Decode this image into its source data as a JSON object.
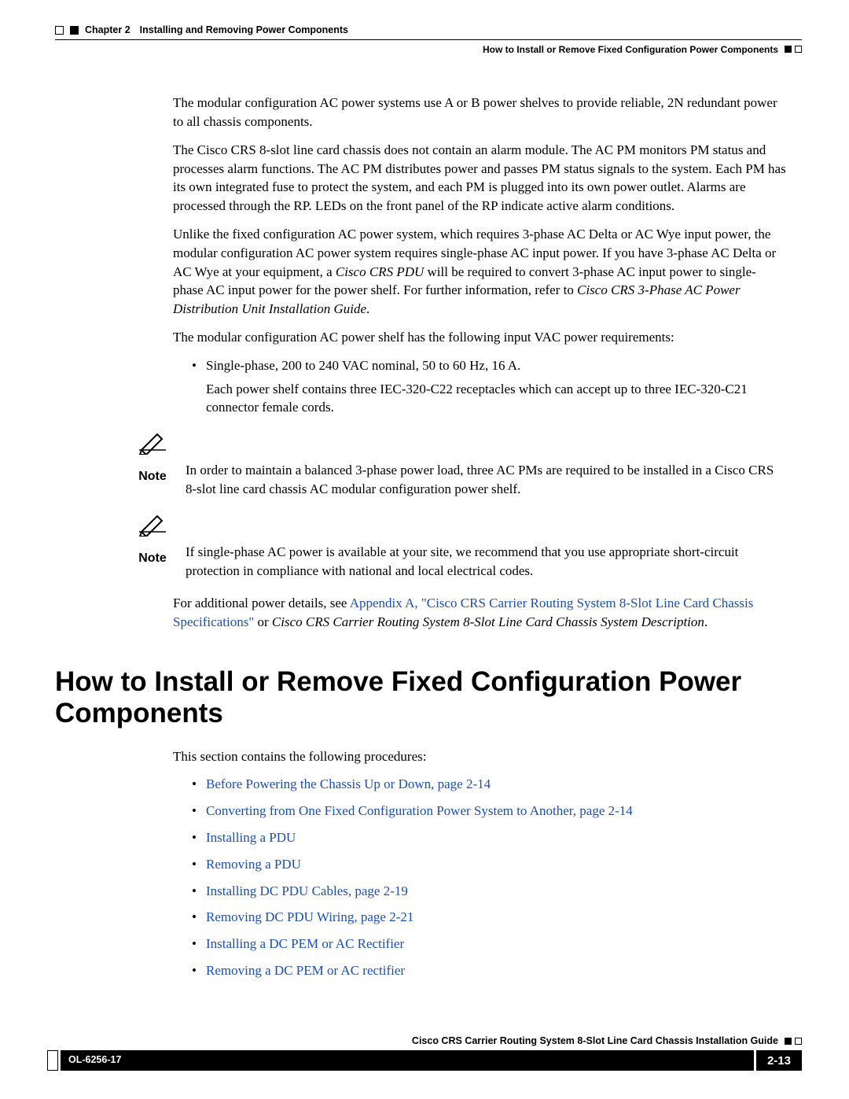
{
  "header": {
    "chapter_label": "Chapter 2",
    "chapter_title": "Installing and Removing Power Components",
    "section_title": "How to Install or Remove Fixed Configuration Power Components"
  },
  "body": {
    "p1": "The modular configuration AC power systems use A or B power shelves to provide reliable, 2N redundant power to all chassis components.",
    "p2": "The Cisco CRS 8-slot line card chassis does not contain an alarm module. The AC PM monitors PM status and processes alarm functions. The AC PM distributes power and passes PM status signals to the system. Each PM has its own integrated fuse to protect the system, and each PM is plugged into its own power outlet. Alarms are processed through the RP. LEDs on the front panel of the RP indicate active alarm conditions.",
    "p3_pre": "Unlike the fixed configuration AC power system, which requires 3-phase AC Delta or AC Wye input power, the modular configuration AC power system requires single-phase AC input power. If you have 3-phase AC Delta or AC Wye at your equipment, a ",
    "p3_em": "Cisco CRS PDU",
    "p3_mid": " will be required to convert 3-phase AC input power to single-phase AC input power for the power shelf. For further information, refer to ",
    "p3_ref": "Cisco CRS 3-Phase AC Power Distribution Unit Installation Guide",
    "p3_end": ".",
    "p4": "The modular configuration AC power shelf has the following input VAC power requirements:",
    "bullet1_a": "Single-phase, 200 to 240 VAC nominal, 50 to 60 Hz, 16 A.",
    "bullet1_b": "Each power shelf contains three IEC-320-C22 receptacles which can accept up to three IEC-320-C21 connector female cords.",
    "note1_label": "Note",
    "note1_text": "In order to maintain a balanced 3-phase power load, three AC PMs are required to be installed in a Cisco CRS 8-slot line card chassis AC modular configuration power shelf.",
    "note2_label": "Note",
    "note2_text": "If single-phase AC power is available at your site, we recommend that you use appropriate short-circuit protection in compliance with national and local electrical codes.",
    "p5_pre": "For additional power details, see ",
    "p5_link": "Appendix A, \"Cisco CRS Carrier Routing System 8-Slot Line Card Chassis Specifications\"",
    "p5_mid": " or ",
    "p5_em": "Cisco CRS Carrier Routing System 8-Slot Line Card Chassis System Description",
    "p5_end": "."
  },
  "section": {
    "heading": "How to Install or Remove Fixed Configuration Power Components",
    "intro": "This section contains the following procedures:",
    "links": [
      "Before Powering the Chassis Up or Down, page 2-14",
      "Converting from One Fixed Configuration Power System to Another, page 2-14",
      "Installing a PDU",
      "Removing a PDU",
      "Installing DC PDU Cables, page 2-19",
      "Removing DC PDU Wiring, page 2-21",
      "Installing a DC PEM or AC Rectifier",
      "Removing a DC PEM or AC rectifier"
    ]
  },
  "footer": {
    "doc_title": "Cisco CRS Carrier Routing System 8-Slot Line Card Chassis Installation Guide",
    "doc_id": "OL-6256-17",
    "page_num": "2-13"
  }
}
